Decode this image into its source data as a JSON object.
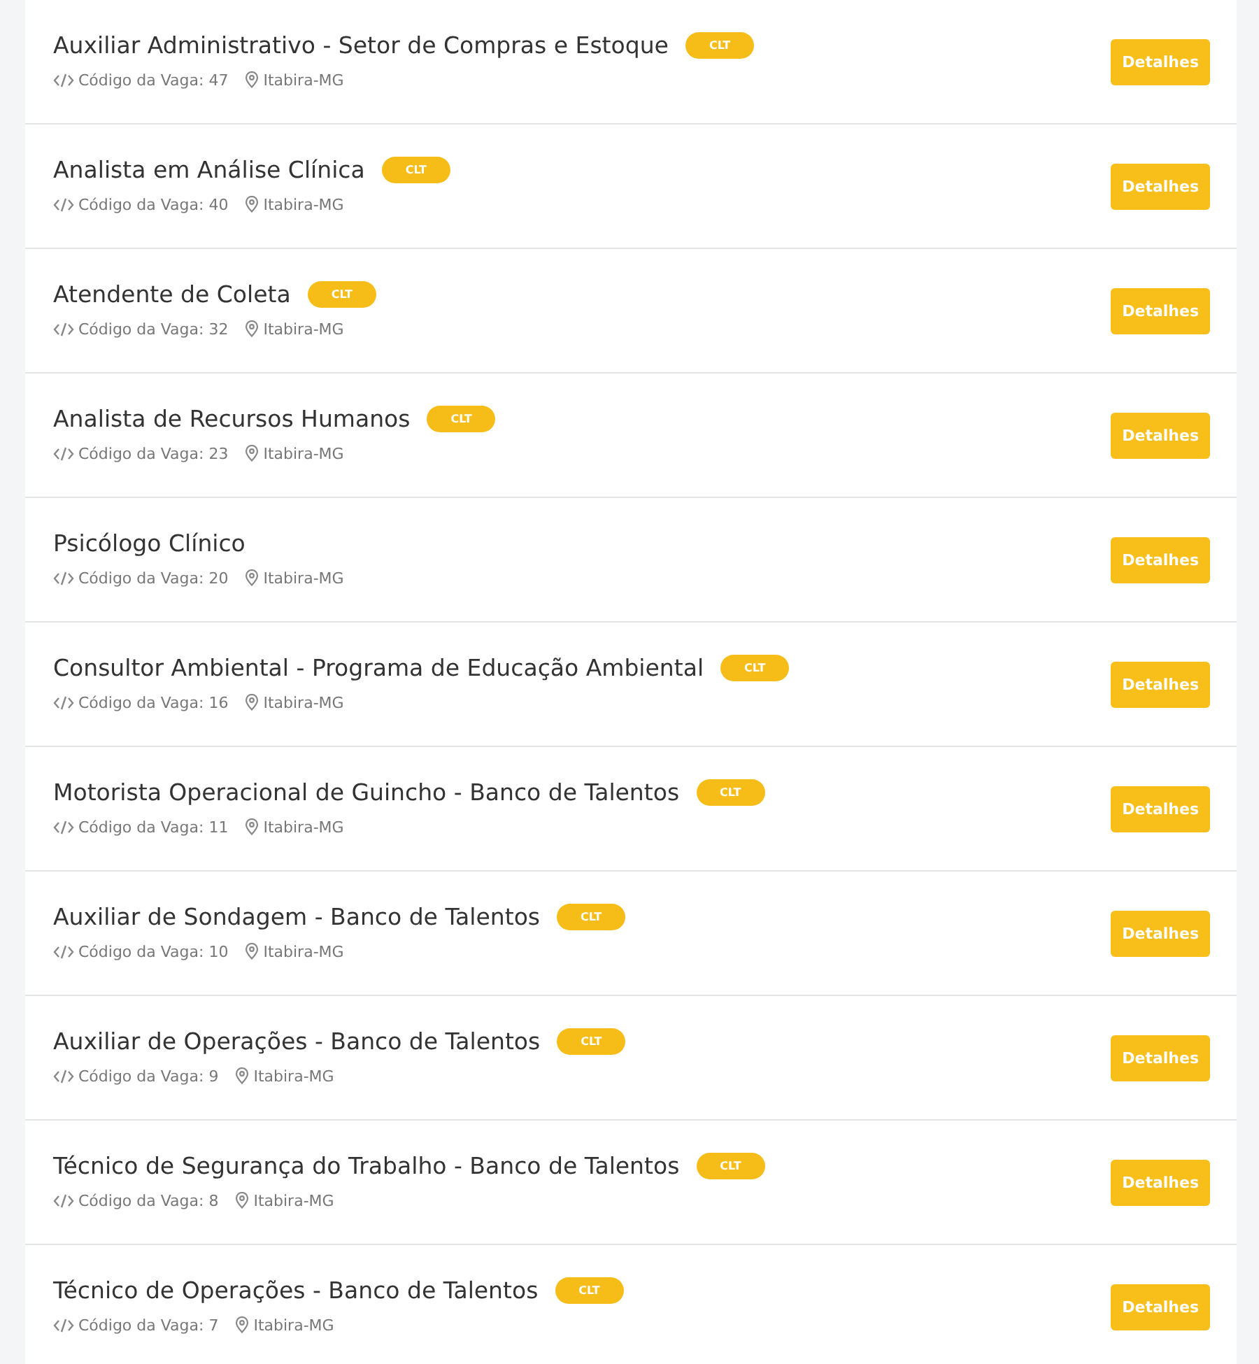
{
  "jobs": [
    {
      "title": "Auxiliar Administrativo - Setor de Compras e Estoque",
      "badge": "CLT",
      "code_label": "Código da Vaga: 47",
      "location": "Itabira-MG",
      "button": "Detalhes"
    },
    {
      "title": "Analista em Análise Clínica",
      "badge": "CLT",
      "code_label": "Código da Vaga: 40",
      "location": "Itabira-MG",
      "button": "Detalhes"
    },
    {
      "title": "Atendente de Coleta",
      "badge": "CLT",
      "code_label": "Código da Vaga: 32",
      "location": "Itabira-MG",
      "button": "Detalhes"
    },
    {
      "title": "Analista de Recursos Humanos",
      "badge": "CLT",
      "code_label": "Código da Vaga: 23",
      "location": "Itabira-MG",
      "button": "Detalhes"
    },
    {
      "title": "Psicólogo Clínico",
      "code_label": "Código da Vaga: 20",
      "location": "Itabira-MG",
      "button": "Detalhes"
    },
    {
      "title": "Consultor Ambiental - Programa de Educação Ambiental",
      "badge": "CLT",
      "code_label": "Código da Vaga: 16",
      "location": "Itabira-MG",
      "button": "Detalhes"
    },
    {
      "title": "Motorista Operacional de Guincho - Banco de Talentos",
      "badge": "CLT",
      "code_label": "Código da Vaga: 11",
      "location": "Itabira-MG",
      "button": "Detalhes"
    },
    {
      "title": "Auxiliar de Sondagem - Banco de Talentos",
      "badge": "CLT",
      "code_label": "Código da Vaga: 10",
      "location": "Itabira-MG",
      "button": "Detalhes"
    },
    {
      "title": "Auxiliar de Operações - Banco de Talentos",
      "badge": "CLT",
      "code_label": "Código da Vaga: 9",
      "location": "Itabira-MG",
      "button": "Detalhes"
    },
    {
      "title": "Técnico de Segurança do Trabalho - Banco de Talentos",
      "badge": "CLT",
      "code_label": "Código da Vaga: 8",
      "location": "Itabira-MG",
      "button": "Detalhes"
    },
    {
      "title": "Técnico de Operações - Banco de Talentos",
      "badge": "CLT",
      "code_label": "Código da Vaga: 7",
      "location": "Itabira-MG",
      "button": "Detalhes"
    }
  ]
}
